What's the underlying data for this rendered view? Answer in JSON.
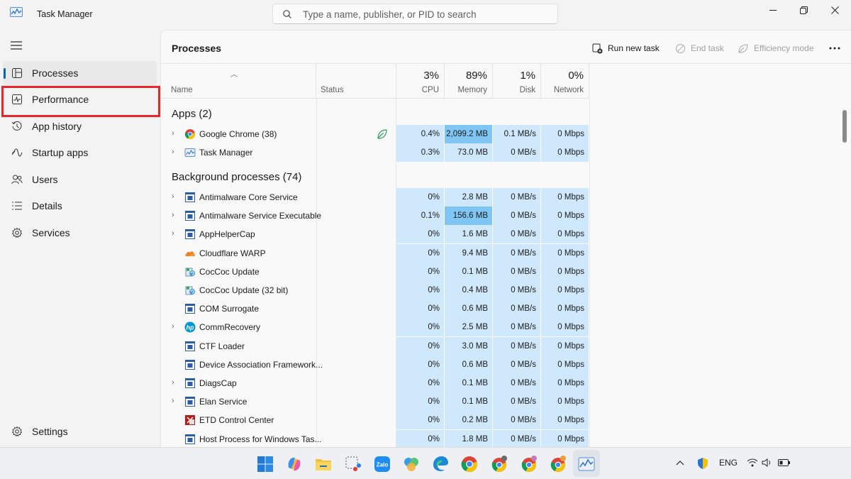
{
  "window": {
    "title": "Task Manager",
    "search_placeholder": "Type a name, publisher, or PID to search"
  },
  "sidebar": {
    "items": [
      {
        "label": "Processes",
        "icon": "processes-icon",
        "active": true
      },
      {
        "label": "Performance",
        "icon": "performance-icon",
        "active": false
      },
      {
        "label": "App history",
        "icon": "history-icon",
        "active": false
      },
      {
        "label": "Startup apps",
        "icon": "startup-icon",
        "active": false
      },
      {
        "label": "Users",
        "icon": "users-icon",
        "active": false
      },
      {
        "label": "Details",
        "icon": "details-icon",
        "active": false
      },
      {
        "label": "Services",
        "icon": "services-icon",
        "active": false
      }
    ],
    "settings_label": "Settings"
  },
  "main": {
    "title": "Processes",
    "commands": {
      "run_new_task": "Run new task",
      "end_task": "End task",
      "efficiency_mode": "Efficiency mode"
    },
    "headers": {
      "name": "Name",
      "status": "Status",
      "cpu_pct": "3%",
      "cpu": "CPU",
      "memory_pct": "89%",
      "memory": "Memory",
      "disk_pct": "1%",
      "disk": "Disk",
      "network_pct": "0%",
      "network": "Network"
    },
    "apps_title": "Apps (2)",
    "apps": [
      {
        "name": "Google Chrome (38)",
        "cpu": "0.4%",
        "memory": "2,099.2 MB",
        "disk": "0.1 MB/s",
        "network": "0 Mbps",
        "expandable": true,
        "icon": "chrome-icon",
        "status_icon": "efficiency-leaf-icon",
        "mem_hot": true
      },
      {
        "name": "Task Manager",
        "cpu": "0.3%",
        "memory": "73.0 MB",
        "disk": "0 MB/s",
        "network": "0 Mbps",
        "expandable": true,
        "icon": "task-manager-icon"
      }
    ],
    "background_title": "Background processes (74)",
    "background": [
      {
        "name": "Antimalware Core Service",
        "cpu": "0%",
        "memory": "2.8 MB",
        "disk": "0 MB/s",
        "network": "0 Mbps",
        "expandable": true,
        "icon": "service-window-icon"
      },
      {
        "name": "Antimalware Service Executable",
        "cpu": "0.1%",
        "memory": "156.6 MB",
        "disk": "0 MB/s",
        "network": "0 Mbps",
        "expandable": true,
        "icon": "service-window-icon",
        "mem_hot": true
      },
      {
        "name": "AppHelperCap",
        "cpu": "0%",
        "memory": "1.6 MB",
        "disk": "0 MB/s",
        "network": "0 Mbps",
        "expandable": true,
        "icon": "service-window-icon"
      },
      {
        "name": "Cloudflare WARP",
        "cpu": "0%",
        "memory": "9.4 MB",
        "disk": "0 MB/s",
        "network": "0 Mbps",
        "expandable": false,
        "icon": "cloudflare-icon"
      },
      {
        "name": "CocCoc Update",
        "cpu": "0%",
        "memory": "0.1 MB",
        "disk": "0 MB/s",
        "network": "0 Mbps",
        "expandable": false,
        "icon": "updater-icon"
      },
      {
        "name": "CocCoc Update (32 bit)",
        "cpu": "0%",
        "memory": "0.4 MB",
        "disk": "0 MB/s",
        "network": "0 Mbps",
        "expandable": false,
        "icon": "updater-icon"
      },
      {
        "name": "COM Surrogate",
        "cpu": "0%",
        "memory": "0.6 MB",
        "disk": "0 MB/s",
        "network": "0 Mbps",
        "expandable": false,
        "icon": "service-window-icon"
      },
      {
        "name": "CommRecovery",
        "cpu": "0%",
        "memory": "2.5 MB",
        "disk": "0 MB/s",
        "network": "0 Mbps",
        "expandable": true,
        "icon": "hp-icon"
      },
      {
        "name": "CTF Loader",
        "cpu": "0%",
        "memory": "3.0 MB",
        "disk": "0 MB/s",
        "network": "0 Mbps",
        "expandable": false,
        "icon": "service-window-icon"
      },
      {
        "name": "Device Association Framework...",
        "cpu": "0%",
        "memory": "0.6 MB",
        "disk": "0 MB/s",
        "network": "0 Mbps",
        "expandable": false,
        "icon": "service-window-icon"
      },
      {
        "name": "DiagsCap",
        "cpu": "0%",
        "memory": "0.1 MB",
        "disk": "0 MB/s",
        "network": "0 Mbps",
        "expandable": true,
        "icon": "service-window-icon"
      },
      {
        "name": "Elan Service",
        "cpu": "0%",
        "memory": "0.1 MB",
        "disk": "0 MB/s",
        "network": "0 Mbps",
        "expandable": true,
        "icon": "service-window-icon"
      },
      {
        "name": "ETD Control Center",
        "cpu": "0%",
        "memory": "0.2 MB",
        "disk": "0 MB/s",
        "network": "0 Mbps",
        "expandable": false,
        "icon": "etd-icon"
      },
      {
        "name": "Host Process for Windows Tas...",
        "cpu": "0%",
        "memory": "1.8 MB",
        "disk": "0 MB/s",
        "network": "0 Mbps",
        "expandable": false,
        "icon": "service-window-icon"
      }
    ]
  },
  "taskbar": {
    "apps": [
      "start-icon",
      "copilot-icon",
      "file-explorer-icon",
      "snipping-tool-icon",
      "zalo-icon",
      "photos-icon",
      "edge-icon",
      "chrome-icon",
      "chrome-profile-icon",
      "chrome-profile-icon",
      "chrome-profile-icon",
      "task-manager-icon"
    ],
    "zalo_label": "Zalo",
    "language": "ENG"
  },
  "colors": {
    "accent": "#0067c0",
    "heat_light": "#cfe8fb",
    "heat_strong": "#7fc6f5",
    "highlight_box": "#e8262b"
  }
}
